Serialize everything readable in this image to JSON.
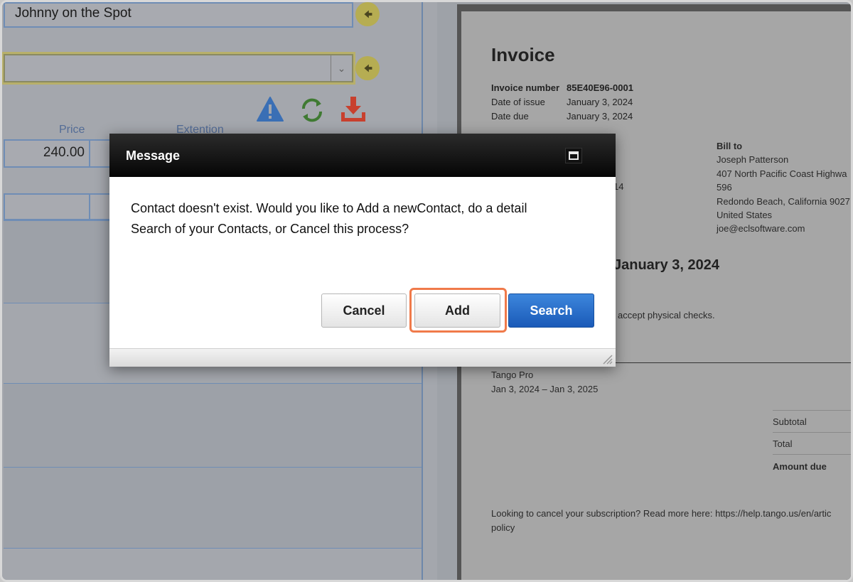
{
  "left_form": {
    "contact_name": "Johnny on the Spot",
    "columns": {
      "price": "Price",
      "extension": "Extention"
    },
    "price_value": "240.00"
  },
  "invoice": {
    "title": "Invoice",
    "number_label": "Invoice number",
    "number_value": "85E40E96-0001",
    "issue_label": "Date of issue",
    "issue_value": "January 3, 2024",
    "due_label": "Date due",
    "due_value": "January 3, 2024",
    "bill_to": {
      "heading": "Bill to",
      "name": "Joseph Patterson",
      "address1": "407 North Pacific Coast Highwa",
      "address2": "596",
      "address3": "Redondo Beach, California 9027",
      "country": "United States",
      "email": "joe@eclsoftware.com"
    },
    "partial_address_fragment": "14",
    "due_headline_fragment": "January 3, 2024",
    "payment_note_fragment": "accept physical checks.",
    "item_name": "Tango Pro",
    "item_period": "Jan 3, 2024 – Jan 3, 2025",
    "subtotal_label": "Subtotal",
    "total_label": "Total",
    "amount_due_label": "Amount due",
    "footer_line1": "Looking to cancel your subscription? Read more here: https://help.tango.us/en/artic",
    "footer_line2": "policy"
  },
  "dialog": {
    "title": "Message",
    "message_line1": "Contact doesn't exist. Would you like to Add a newContact, do a detail",
    "message_line2": "Search of your Contacts, or Cancel this process?",
    "buttons": {
      "cancel": "Cancel",
      "add": "Add",
      "search": "Search"
    }
  },
  "icons": {
    "back_arrow": "arrow-left-circle-icon",
    "warning": "warning-triangle-icon",
    "refresh": "refresh-icon",
    "download": "download-icon",
    "maximize": "maximize-icon",
    "resize": "resize-grip-icon"
  },
  "colors": {
    "accent_blue": "#2a6fcb",
    "highlight_orange": "#f07a4a",
    "warning_blue": "#3a6fb5",
    "refresh_green": "#3f7a32",
    "download_red": "#c8402e",
    "arrow_gold": "#b6ad52"
  }
}
